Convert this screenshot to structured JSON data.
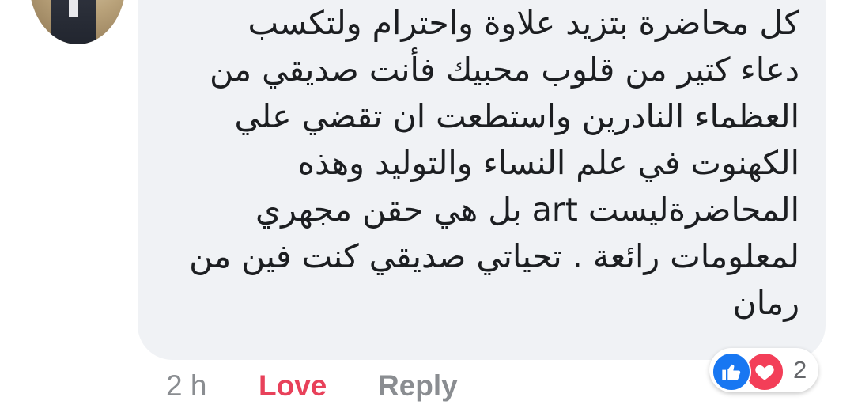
{
  "comment": {
    "lines": [
      "كل محاضرة بتزيد علاوة واحترام ولتكسب",
      "دعاء كتير من قلوب محبيك فأنت صديقي من",
      "العظماء النادرين واستطعت ان تقضي علي",
      "الكهنوت في علم النساء والتوليد وهذه",
      "المحاضرةليست art بل هي حقن مجهري",
      "لمعلومات رائعة . تحياتي صديقي كنت فين من",
      "رمان"
    ]
  },
  "actions": {
    "timestamp": "2 h",
    "love_label": "Love",
    "reply_label": "Reply"
  },
  "reactions": {
    "icons": [
      "like-icon",
      "heart-icon"
    ],
    "count": "2",
    "colors": {
      "like": "#1877f2",
      "heart": "#f33e58",
      "love_text": "#e8415a"
    }
  }
}
